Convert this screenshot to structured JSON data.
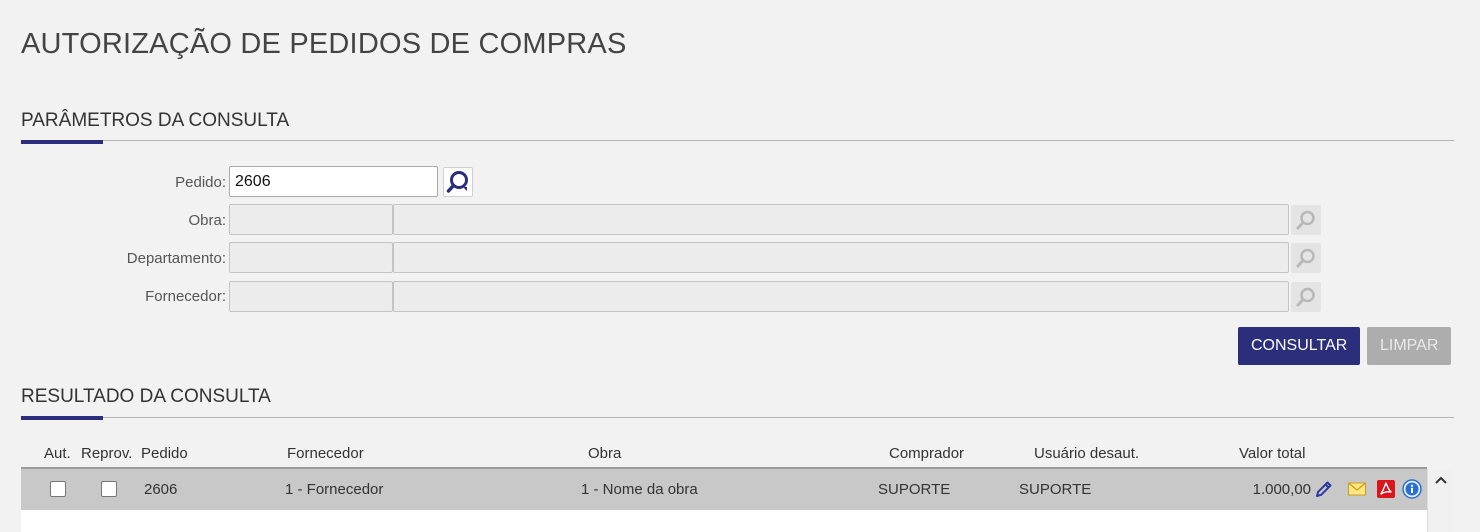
{
  "page": {
    "title": "AUTORIZAÇÃO DE PEDIDOS DE COMPRAS"
  },
  "parametros": {
    "title": "PARÂMETROS DA CONSULTA",
    "pedido": {
      "label": "Pedido:",
      "value": "2606"
    },
    "obra": {
      "label": "Obra:",
      "code": "",
      "name": ""
    },
    "departamento": {
      "label": "Departamento:",
      "code": "",
      "name": ""
    },
    "fornecedor": {
      "label": "Fornecedor:",
      "code": "",
      "name": ""
    },
    "consultar_label": "CONSULTAR",
    "limpar_label": "LIMPAR"
  },
  "resultado": {
    "title": "RESULTADO DA CONSULTA",
    "columns": {
      "aut": "Aut.",
      "reprov": "Reprov.",
      "pedido": "Pedido",
      "fornecedor": "Fornecedor",
      "obra": "Obra",
      "comprador": "Comprador",
      "usuario": "Usuário desaut.",
      "valor": "Valor total"
    },
    "rows": [
      {
        "aut": false,
        "reprov": false,
        "pedido": "2606",
        "fornecedor": "1 - Fornecedor",
        "obra": "1 - Nome da obra",
        "comprador": "SUPORTE",
        "usuario": "SUPORTE",
        "valor": "1.000,00",
        "icons": [
          "edit-icon",
          "email-icon",
          "pdf-icon",
          "info-icon"
        ]
      }
    ]
  },
  "colors": {
    "primary": "#2b2e7a",
    "disabled": "#adadad",
    "row_selected": "#c8c8c8"
  }
}
